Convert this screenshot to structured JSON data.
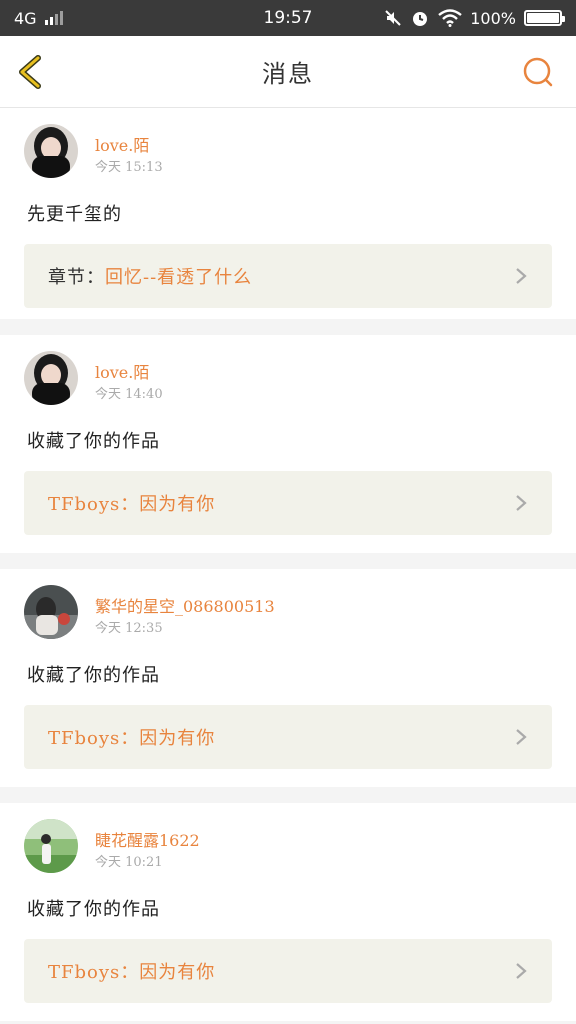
{
  "status_bar": {
    "network": "4G",
    "time": "19:57",
    "battery": "100%"
  },
  "header": {
    "title": "消息"
  },
  "messages": [
    {
      "username": "love.陌",
      "time": "今天 15:13",
      "text": "先更千玺的",
      "link_prefix": "章节：",
      "link_title": "回忆--看透了什么"
    },
    {
      "username": "love.陌",
      "time": "今天 14:40",
      "text": "收藏了你的作品",
      "link_prefix": "",
      "link_title": "TFboys：因为有你"
    },
    {
      "username": "繁华的星空_086800513",
      "time": "今天 12:35",
      "text": "收藏了你的作品",
      "link_prefix": "",
      "link_title": "TFboys：因为有你"
    },
    {
      "username": "睫花醒露1622",
      "time": "今天 10:21",
      "text": "收藏了你的作品",
      "link_prefix": "",
      "link_title": "TFboys：因为有你"
    }
  ],
  "colors": {
    "accent": "#e8843e",
    "back_icon": "#e8c020",
    "status_bar_bg": "#3a3a3a",
    "link_bg": "#f2f2ea"
  }
}
